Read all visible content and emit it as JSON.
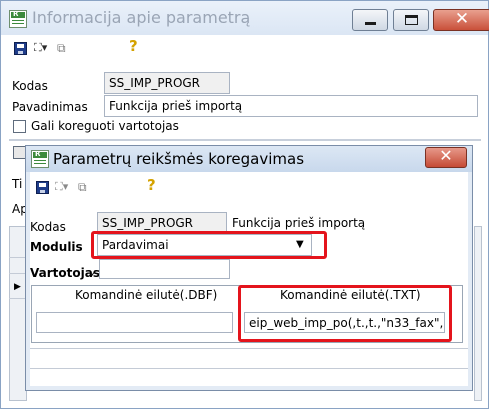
{
  "outer_window": {
    "title": "Informacija apie parametrą",
    "fields": {
      "kodas_label": "Kodas",
      "kodas_value": "SS_IMP_PROGR",
      "pavadinimas_label": "Pavadinimas",
      "pavadinimas_value": "Funkcija prieš importą",
      "checkbox_label": "Gali koreguoti vartotojas",
      "partial_label_1": "Ti",
      "partial_label_2": "Ap"
    },
    "toolbar_icons": [
      "save-icon",
      "network-icon",
      "copy-icon",
      "help-icon"
    ]
  },
  "dialog": {
    "title": "Parametrų reikšmės koregavimas",
    "toolbar_icons": [
      "save-icon",
      "network-icon",
      "copy-icon",
      "help-icon"
    ],
    "kodas_label": "Kodas",
    "kodas_value": "SS_IMP_PROGR",
    "description": "Funkcija prieš importą",
    "modulis_label": "Modulis",
    "modulis_value": "Pardavimai",
    "vartotojas_label": "Vartotojas",
    "vartotojas_check": "✓",
    "dbf_label": "Komandinė eilutė(.DBF)",
    "dbf_value": "",
    "txt_label": "Komandinė eilutė(.TXT)",
    "txt_value": "eip_web_imp_po(,t.,t.,\"n33_fax\",@in"
  },
  "colors": {
    "highlight_red": "#e4141c",
    "close_button": "#c54a35",
    "title_inactive": "#9aa5b5"
  }
}
